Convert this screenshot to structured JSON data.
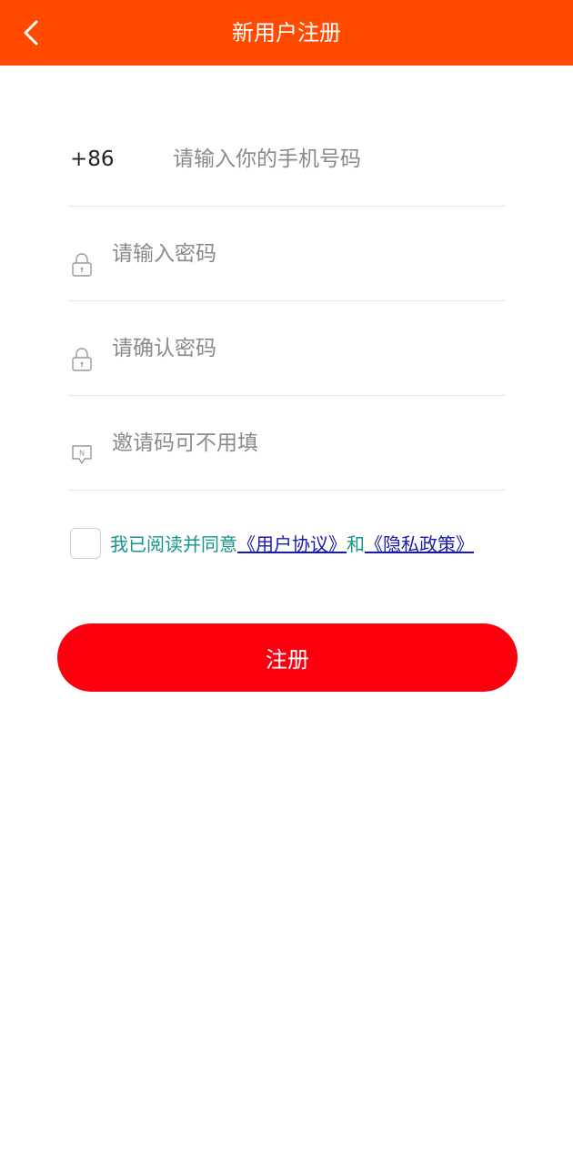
{
  "header": {
    "title": "新用户注册",
    "back_icon": "chevron-left-icon"
  },
  "form": {
    "phone": {
      "prefix": "+86",
      "placeholder": "请输入你的手机号码",
      "value": ""
    },
    "password": {
      "icon": "lock-icon",
      "placeholder": "请输入密码",
      "value": ""
    },
    "confirm_password": {
      "icon": "lock-icon",
      "placeholder": "请确认密码",
      "value": ""
    },
    "invite_code": {
      "icon": "message-icon",
      "placeholder": "邀请码可不用填",
      "value": ""
    }
  },
  "agreement": {
    "checked": false,
    "prefix": "我已阅读并同意",
    "user_agreement": "《用户协议》",
    "conjunction": "和",
    "privacy_policy": "《隐私政策》"
  },
  "submit": {
    "label": "注册"
  },
  "colors": {
    "header_bg": "#ff4a00",
    "button_bg": "#fc000f",
    "agree_text": "#13958a",
    "link": "#1a1aa8"
  }
}
